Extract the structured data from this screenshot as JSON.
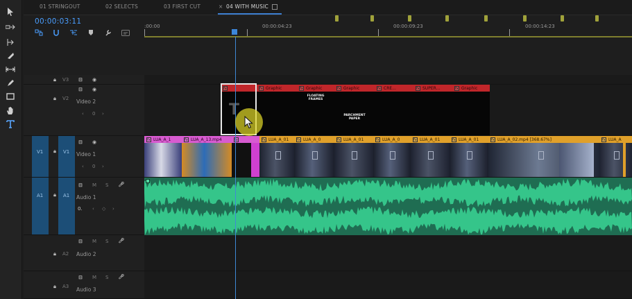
{
  "tabs": [
    "01 STRINGOUT",
    "02 SELECTS",
    "03 FIRST CUT",
    "04 WITH MUSIC"
  ],
  "active_tab": 3,
  "timecode": "00:00:03:11",
  "ruler": {
    "labels": [
      ":00:00",
      "00:00:04:23",
      "00:00:09:23",
      "00:00:14:23"
    ]
  },
  "tracks": {
    "v3": {
      "label": "V3"
    },
    "v2": {
      "label": "V2",
      "name": "Video 2",
      "value": "0"
    },
    "v1": {
      "label": "V1",
      "source": "V1",
      "name": "Video 1",
      "value": "0"
    },
    "a1": {
      "label": "A1",
      "source": "A1",
      "name": "Audio 1",
      "value": "0.",
      "m": "M",
      "s": "S"
    },
    "a2": {
      "label": "A2",
      "name": "Audio 2",
      "m": "M",
      "s": "S"
    },
    "a3": {
      "label": "A3",
      "name": "Audio 3",
      "m": "M",
      "s": "S"
    }
  },
  "v2_clips": [
    {
      "label": "",
      "text": ""
    },
    {
      "label": "Graphic",
      "text": ""
    },
    {
      "label": "Graphic",
      "text": "FLOATING\nFRAMES"
    },
    {
      "label": "Graphic",
      "text": "PARCHMENT\nPAPER"
    },
    {
      "label": "CRE...",
      "text": ""
    },
    {
      "label": "SUPER...",
      "text": ""
    },
    {
      "label": "Graphic",
      "text": ""
    }
  ],
  "v1_clips": [
    {
      "label": "LUA_A_1",
      "pink": true
    },
    {
      "label": "LUA_A_13.mp4",
      "pink": true
    },
    {
      "label": "",
      "pink": true
    },
    {
      "label": "LUA_A_01",
      "pink": false
    },
    {
      "label": "LUA_A_0",
      "pink": false
    },
    {
      "label": "LUA_A_01",
      "pink": false
    },
    {
      "label": "LUA_A_0",
      "pink": false
    },
    {
      "label": "LUA_A_01",
      "pink": false
    },
    {
      "label": "LUA_A_01",
      "pink": false
    },
    {
      "label": "LUA_A_02.mp4 [368.67%]",
      "pink": false
    },
    {
      "label": "LUA_A",
      "pink": false
    }
  ],
  "colors": {
    "accent": "#4a9eff",
    "v2_clip": "#c0262a",
    "v1_clip": "#e0a02a",
    "v1_clip_pink": "#d75bd0",
    "audio": "#1f6d52",
    "waveform": "#35c58a"
  }
}
